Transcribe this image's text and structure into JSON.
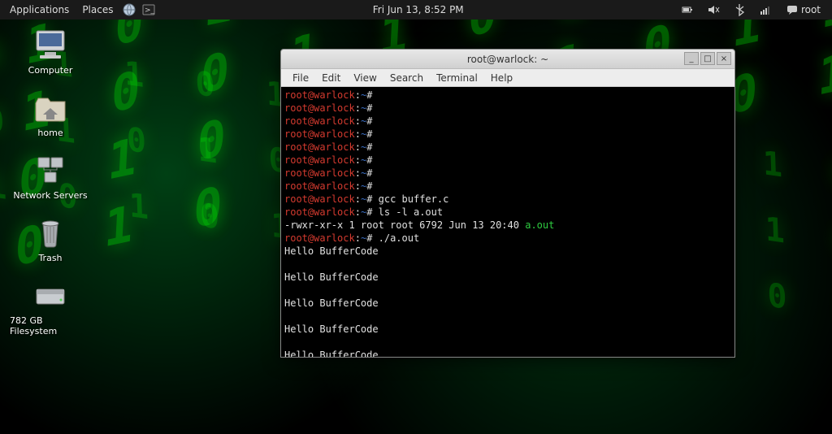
{
  "panel": {
    "applications": "Applications",
    "places": "Places",
    "clock": "Fri Jun 13,  8:52 PM",
    "user": "root"
  },
  "desktop": {
    "icons": [
      {
        "name": "computer",
        "label": "Computer"
      },
      {
        "name": "home",
        "label": "home"
      },
      {
        "name": "network-servers",
        "label": "Network Servers"
      },
      {
        "name": "trash",
        "label": "Trash"
      },
      {
        "name": "filesystem",
        "label": "782 GB Filesystem"
      }
    ]
  },
  "terminal": {
    "title": "root@warlock: ~",
    "menu": {
      "file": "File",
      "edit": "Edit",
      "view": "View",
      "search": "Search",
      "terminal": "Terminal",
      "help": "Help"
    },
    "prompt": {
      "user": "root",
      "at": "@",
      "host": "warlock",
      "sep": ":",
      "path": "~",
      "hash": "#"
    },
    "lines": [
      {
        "type": "prompt",
        "cmd": ""
      },
      {
        "type": "prompt",
        "cmd": ""
      },
      {
        "type": "prompt",
        "cmd": ""
      },
      {
        "type": "prompt",
        "cmd": ""
      },
      {
        "type": "prompt",
        "cmd": ""
      },
      {
        "type": "prompt",
        "cmd": ""
      },
      {
        "type": "prompt",
        "cmd": ""
      },
      {
        "type": "prompt",
        "cmd": ""
      },
      {
        "type": "prompt",
        "cmd": "gcc buffer.c"
      },
      {
        "type": "prompt",
        "cmd": "ls -l a.out"
      },
      {
        "type": "output",
        "text": "-rwxr-xr-x 1 root root 6792 Jun 13 20:40 ",
        "file": "a.out"
      },
      {
        "type": "prompt",
        "cmd": "./a.out"
      },
      {
        "type": "output",
        "text": "Hello BufferCode"
      },
      {
        "type": "blank"
      },
      {
        "type": "output",
        "text": "Hello BufferCode"
      },
      {
        "type": "blank"
      },
      {
        "type": "output",
        "text": "Hello BufferCode"
      },
      {
        "type": "blank"
      },
      {
        "type": "output",
        "text": "Hello BufferCode"
      },
      {
        "type": "blank"
      },
      {
        "type": "output",
        "text": "Hello BufferCode"
      },
      {
        "type": "blank"
      },
      {
        "type": "cursor"
      }
    ]
  }
}
